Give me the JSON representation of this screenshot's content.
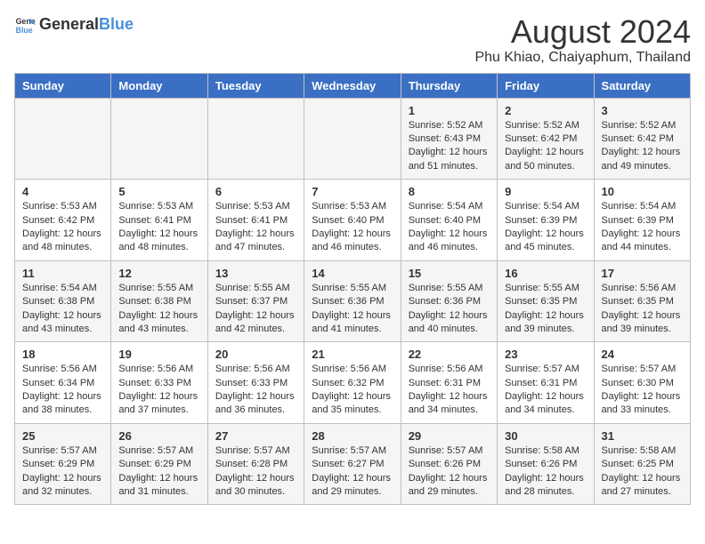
{
  "logo": {
    "text_general": "General",
    "text_blue": "Blue"
  },
  "title": "August 2024",
  "subtitle": "Phu Khiao, Chaiyaphum, Thailand",
  "days_of_week": [
    "Sunday",
    "Monday",
    "Tuesday",
    "Wednesday",
    "Thursday",
    "Friday",
    "Saturday"
  ],
  "weeks": [
    [
      {
        "day": "",
        "info": ""
      },
      {
        "day": "",
        "info": ""
      },
      {
        "day": "",
        "info": ""
      },
      {
        "day": "",
        "info": ""
      },
      {
        "day": "1",
        "info": "Sunrise: 5:52 AM\nSunset: 6:43 PM\nDaylight: 12 hours\nand 51 minutes."
      },
      {
        "day": "2",
        "info": "Sunrise: 5:52 AM\nSunset: 6:42 PM\nDaylight: 12 hours\nand 50 minutes."
      },
      {
        "day": "3",
        "info": "Sunrise: 5:52 AM\nSunset: 6:42 PM\nDaylight: 12 hours\nand 49 minutes."
      }
    ],
    [
      {
        "day": "4",
        "info": "Sunrise: 5:53 AM\nSunset: 6:42 PM\nDaylight: 12 hours\nand 48 minutes."
      },
      {
        "day": "5",
        "info": "Sunrise: 5:53 AM\nSunset: 6:41 PM\nDaylight: 12 hours\nand 48 minutes."
      },
      {
        "day": "6",
        "info": "Sunrise: 5:53 AM\nSunset: 6:41 PM\nDaylight: 12 hours\nand 47 minutes."
      },
      {
        "day": "7",
        "info": "Sunrise: 5:53 AM\nSunset: 6:40 PM\nDaylight: 12 hours\nand 46 minutes."
      },
      {
        "day": "8",
        "info": "Sunrise: 5:54 AM\nSunset: 6:40 PM\nDaylight: 12 hours\nand 46 minutes."
      },
      {
        "day": "9",
        "info": "Sunrise: 5:54 AM\nSunset: 6:39 PM\nDaylight: 12 hours\nand 45 minutes."
      },
      {
        "day": "10",
        "info": "Sunrise: 5:54 AM\nSunset: 6:39 PM\nDaylight: 12 hours\nand 44 minutes."
      }
    ],
    [
      {
        "day": "11",
        "info": "Sunrise: 5:54 AM\nSunset: 6:38 PM\nDaylight: 12 hours\nand 43 minutes."
      },
      {
        "day": "12",
        "info": "Sunrise: 5:55 AM\nSunset: 6:38 PM\nDaylight: 12 hours\nand 43 minutes."
      },
      {
        "day": "13",
        "info": "Sunrise: 5:55 AM\nSunset: 6:37 PM\nDaylight: 12 hours\nand 42 minutes."
      },
      {
        "day": "14",
        "info": "Sunrise: 5:55 AM\nSunset: 6:36 PM\nDaylight: 12 hours\nand 41 minutes."
      },
      {
        "day": "15",
        "info": "Sunrise: 5:55 AM\nSunset: 6:36 PM\nDaylight: 12 hours\nand 40 minutes."
      },
      {
        "day": "16",
        "info": "Sunrise: 5:55 AM\nSunset: 6:35 PM\nDaylight: 12 hours\nand 39 minutes."
      },
      {
        "day": "17",
        "info": "Sunrise: 5:56 AM\nSunset: 6:35 PM\nDaylight: 12 hours\nand 39 minutes."
      }
    ],
    [
      {
        "day": "18",
        "info": "Sunrise: 5:56 AM\nSunset: 6:34 PM\nDaylight: 12 hours\nand 38 minutes."
      },
      {
        "day": "19",
        "info": "Sunrise: 5:56 AM\nSunset: 6:33 PM\nDaylight: 12 hours\nand 37 minutes."
      },
      {
        "day": "20",
        "info": "Sunrise: 5:56 AM\nSunset: 6:33 PM\nDaylight: 12 hours\nand 36 minutes."
      },
      {
        "day": "21",
        "info": "Sunrise: 5:56 AM\nSunset: 6:32 PM\nDaylight: 12 hours\nand 35 minutes."
      },
      {
        "day": "22",
        "info": "Sunrise: 5:56 AM\nSunset: 6:31 PM\nDaylight: 12 hours\nand 34 minutes."
      },
      {
        "day": "23",
        "info": "Sunrise: 5:57 AM\nSunset: 6:31 PM\nDaylight: 12 hours\nand 34 minutes."
      },
      {
        "day": "24",
        "info": "Sunrise: 5:57 AM\nSunset: 6:30 PM\nDaylight: 12 hours\nand 33 minutes."
      }
    ],
    [
      {
        "day": "25",
        "info": "Sunrise: 5:57 AM\nSunset: 6:29 PM\nDaylight: 12 hours\nand 32 minutes."
      },
      {
        "day": "26",
        "info": "Sunrise: 5:57 AM\nSunset: 6:29 PM\nDaylight: 12 hours\nand 31 minutes."
      },
      {
        "day": "27",
        "info": "Sunrise: 5:57 AM\nSunset: 6:28 PM\nDaylight: 12 hours\nand 30 minutes."
      },
      {
        "day": "28",
        "info": "Sunrise: 5:57 AM\nSunset: 6:27 PM\nDaylight: 12 hours\nand 29 minutes."
      },
      {
        "day": "29",
        "info": "Sunrise: 5:57 AM\nSunset: 6:26 PM\nDaylight: 12 hours\nand 29 minutes."
      },
      {
        "day": "30",
        "info": "Sunrise: 5:58 AM\nSunset: 6:26 PM\nDaylight: 12 hours\nand 28 minutes."
      },
      {
        "day": "31",
        "info": "Sunrise: 5:58 AM\nSunset: 6:25 PM\nDaylight: 12 hours\nand 27 minutes."
      }
    ]
  ]
}
